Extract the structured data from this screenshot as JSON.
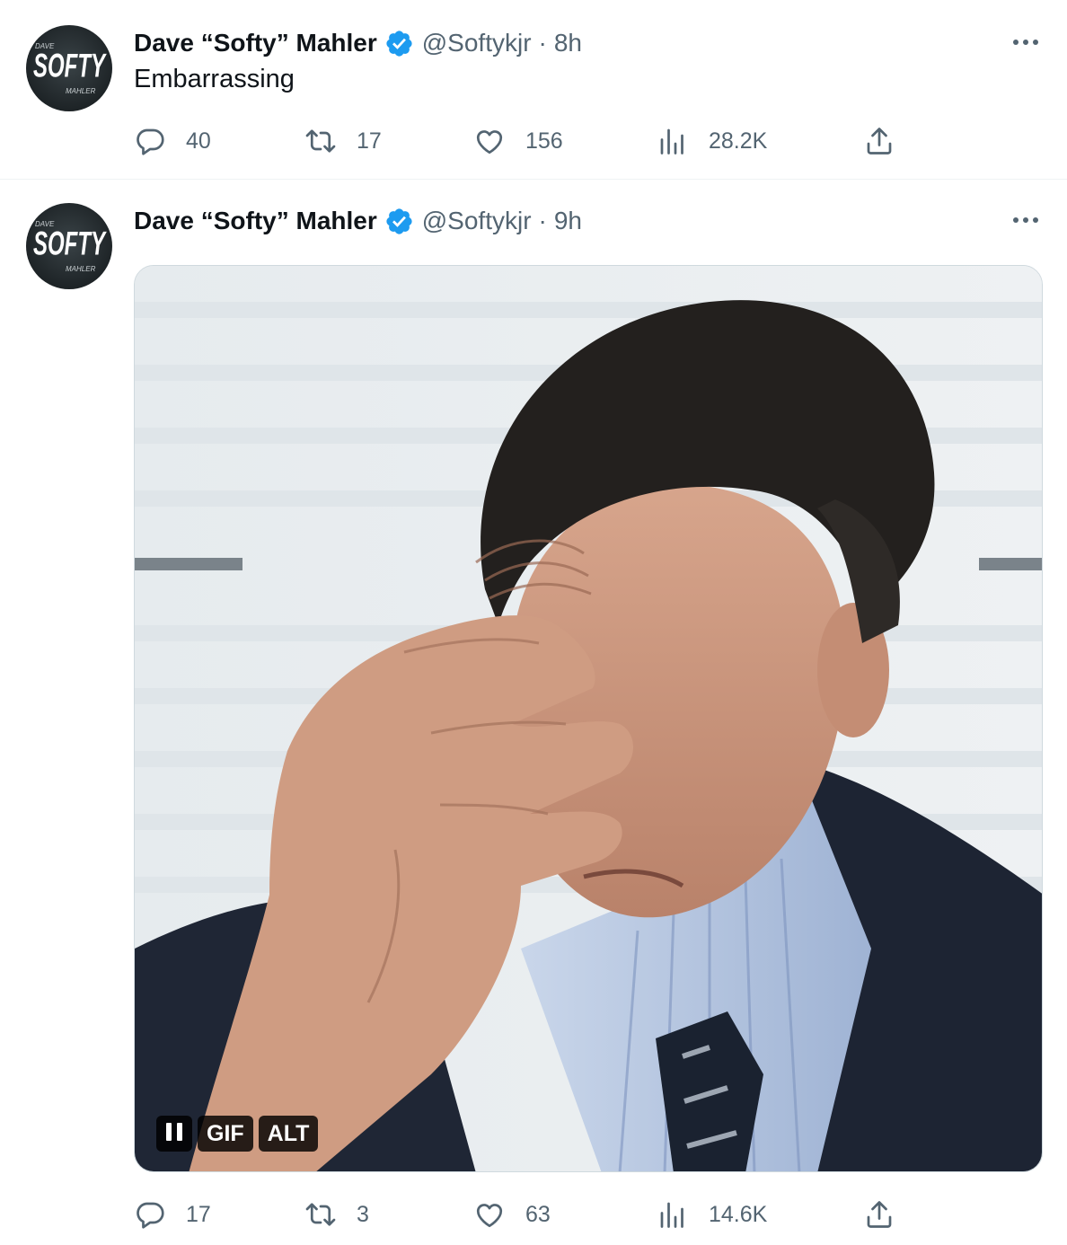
{
  "colors": {
    "verified": "#1d9bf0",
    "text_primary": "#0f1419",
    "text_secondary": "#536471",
    "divider": "#eff3f4"
  },
  "tweets": [
    {
      "author": {
        "display_name": "Dave “Softy” Mahler",
        "handle": "@Softykjr",
        "avatar_text": {
          "top": "DAVE",
          "main": "SOFTY",
          "bottom": "MAHLER"
        }
      },
      "separator": "·",
      "time": "8h",
      "text": "Embarrassing",
      "stats": {
        "replies": "40",
        "retweets": "17",
        "likes": "156",
        "views": "28.2K"
      },
      "icons": [
        "reply-icon",
        "retweet-icon",
        "like-icon",
        "views-icon",
        "share-icon",
        "more-icon",
        "verified-badge-icon"
      ]
    },
    {
      "author": {
        "display_name": "Dave “Softy” Mahler",
        "handle": "@Softykjr",
        "avatar_text": {
          "top": "DAVE",
          "main": "SOFTY",
          "bottom": "MAHLER"
        }
      },
      "separator": "·",
      "time": "9h",
      "media": {
        "type": "gif",
        "gif_label": "GIF",
        "alt_label": "ALT",
        "state": "playing"
      },
      "stats": {
        "replies": "17",
        "retweets": "3",
        "likes": "63",
        "views": "14.6K"
      },
      "icons": [
        "reply-icon",
        "retweet-icon",
        "like-icon",
        "views-icon",
        "share-icon",
        "more-icon",
        "verified-badge-icon",
        "pause-icon"
      ]
    }
  ]
}
